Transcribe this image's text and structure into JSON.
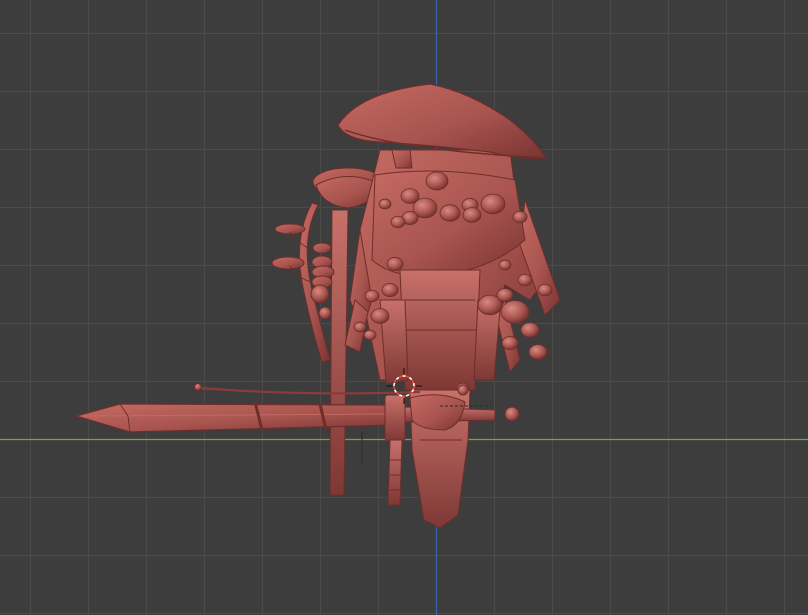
{
  "viewport": {
    "view": "front-orthographic",
    "shading": "solid-clay",
    "grid": true,
    "colors": {
      "background": "#3d3d3d",
      "grid_line": "#4b4b4b",
      "x_axis": "#7ea236",
      "z_axis": "#3a62a8",
      "clay": "#a8544f",
      "clay_light": "#c86d66",
      "clay_dark": "#7a3431",
      "cursor_red": "#e34a3a"
    },
    "icons": {
      "cursor": "3d-cursor-icon"
    }
  }
}
